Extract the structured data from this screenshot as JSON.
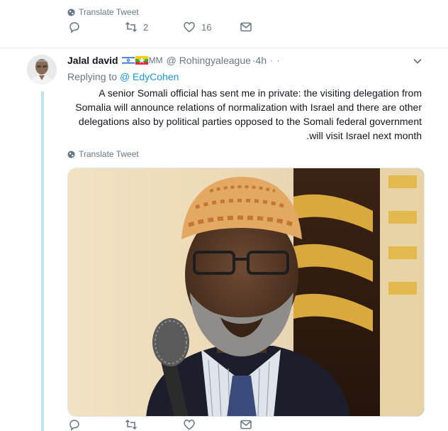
{
  "top_tweet": {
    "translate_label": "Translate Tweet",
    "retweets": "2",
    "likes": "16"
  },
  "tweet": {
    "author_name": "Jalal david",
    "flags_suffix": "MM",
    "handle": "@ Rohingyaleague",
    "time": "·4h",
    "more_dots": "· ·",
    "replying_prefix": "Replying to",
    "replying_to": "@ EdyCohen",
    "text": "A senior Somali official has sent me in private: the visiting delegation from Somalia will announce relations of normalization with Israel and there are other delegations also by political parties opposed to the Somali federal government .will visit Israel next month",
    "translate_label": "Translate Tweet"
  },
  "colors": {
    "accent": "#1b95e0",
    "muted": "#657786",
    "border": "#e6ecf0"
  },
  "icons": [
    "globe-icon",
    "reply-icon",
    "retweet-icon",
    "like-icon",
    "message-icon",
    "chevron-down-icon"
  ]
}
